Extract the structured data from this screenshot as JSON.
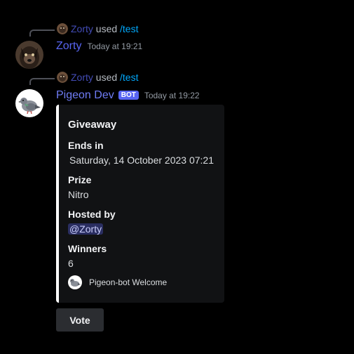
{
  "messages": [
    {
      "reply": {
        "user": "Zorty",
        "used": "used",
        "command": "/test"
      },
      "author": "Zorty",
      "timestamp": "Today at 19:21"
    },
    {
      "reply": {
        "user": "Zorty",
        "used": "used",
        "command": "/test"
      },
      "author": "Pigeon Dev",
      "bot_tag": "BOT",
      "timestamp": "Today at 19:22",
      "embed": {
        "title": "Giveaway",
        "accent_color": "#ffffff",
        "fields": [
          {
            "name": "Ends in",
            "value": "Saturday, 14 October 2023 07:21"
          },
          {
            "name": "Prize",
            "value": "Nitro"
          },
          {
            "name": "Hosted by",
            "value": "@Zorty"
          },
          {
            "name": "Winners",
            "value": "6"
          }
        ],
        "footer": "Pigeon-bot Welcome"
      },
      "button": {
        "label": "Vote"
      }
    }
  ],
  "colors": {
    "background": "#000000",
    "username": "#5865f2",
    "command": "#00a8fc",
    "embed_bg": "#111214",
    "button_bg": "#2b2d31"
  },
  "icons": {
    "user_avatar": "dog-avatar-icon",
    "bot_avatar": "pigeon-avatar-icon"
  }
}
